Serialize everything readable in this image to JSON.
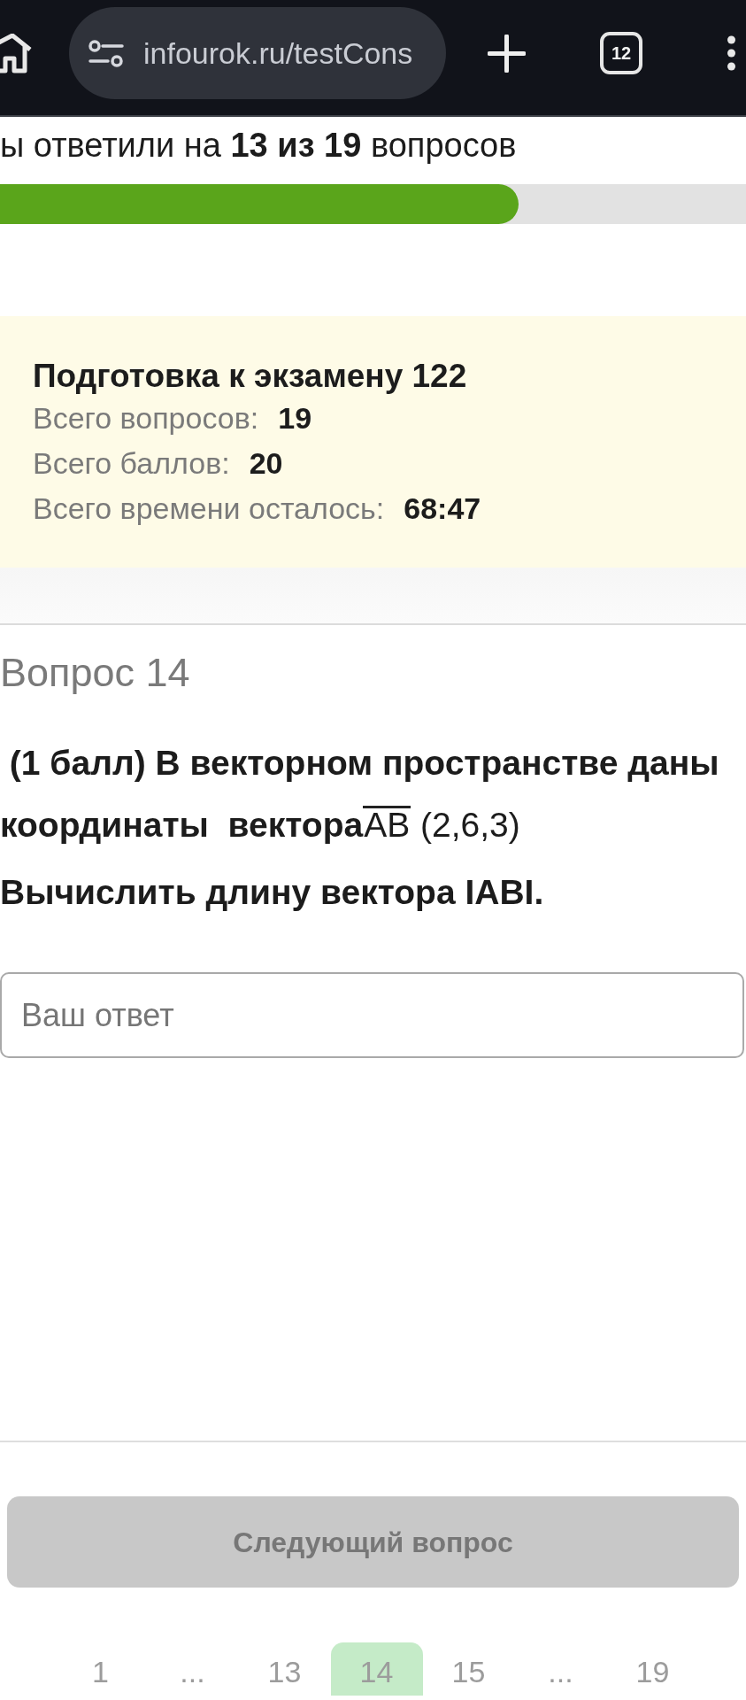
{
  "browser": {
    "url": "infourok.ru/testCons",
    "tab_count": "12"
  },
  "progress": {
    "text": "ы ответили на **13 из 19** вопросов",
    "level": 0.695
  },
  "test_info": {
    "title": "Подготовка к экзамену 122",
    "rows": [
      {
        "label": "Всего вопросов:",
        "value": "19"
      },
      {
        "label": "Всего баллов:",
        "value": "20"
      },
      {
        "label": "Всего времени осталось:",
        "value": "68:47"
      }
    ]
  },
  "question": {
    "title": "Вопрос 14",
    "statement": " (1 балл) В векторном пространстве даны координаты  вектора",
    "vector": "AB",
    "coordinates": " (2,6,3)",
    "task": "Вычислить длину вектора IABI."
  },
  "answer": {
    "placeholder": "Ваш ответ"
  },
  "next_button": {
    "label": "Следующий вопрос",
    "disabled": true
  },
  "pagination": [
    {
      "label": "1",
      "selected": false
    },
    {
      "label": "...",
      "selected": false
    },
    {
      "label": "13",
      "selected": false
    },
    {
      "label": "14",
      "selected": true
    },
    {
      "label": "15",
      "selected": false
    },
    {
      "label": "...",
      "selected": false
    },
    {
      "label": "19",
      "selected": false
    }
  ]
}
